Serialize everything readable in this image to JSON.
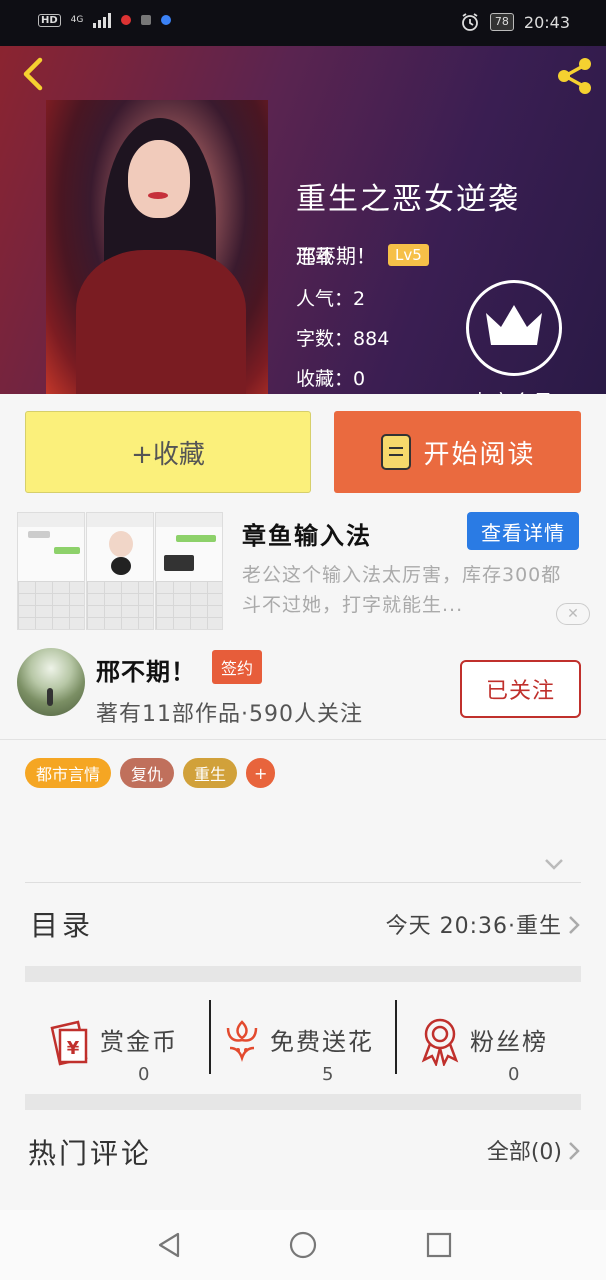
{
  "status_bar": {
    "hd": "HD",
    "network": "4G",
    "battery": "78",
    "time": "20:43"
  },
  "book": {
    "title": "重生之恶女逆袭",
    "author": "邢不期！",
    "author_level": "Lv5",
    "status": "连载",
    "popularity_label": "人气：",
    "popularity": "2",
    "words_label": "字数：",
    "words": "884",
    "favorites_label": "收藏：",
    "favorites": "0",
    "vip_label": "点亮会员"
  },
  "actions": {
    "favorite_label": "+收藏",
    "read_label": "开始阅读"
  },
  "ad": {
    "title": "章鱼输入法",
    "button": "查看详情",
    "description": "老公这个输入法太厉害，库存300都斗不过她，打字就能生..."
  },
  "author_card": {
    "name": "邢不期！",
    "badge": "签约",
    "stats": "著有11部作品·590人关注",
    "follow_label": "已关注"
  },
  "tags": [
    {
      "label": "都市言情",
      "color": "#f5a623"
    },
    {
      "label": "复仇",
      "color": "#c0705c"
    },
    {
      "label": "重生",
      "color": "#d1a13a"
    },
    {
      "label": "+",
      "color": "#e8643c"
    }
  ],
  "toc": {
    "label": "目录",
    "latest": "今天 20:36·重生"
  },
  "stats": [
    {
      "label": "赏金币",
      "value": "0",
      "icon": "red-envelope-yen-icon"
    },
    {
      "label": "免费送花",
      "value": "5",
      "icon": "flower-icon"
    },
    {
      "label": "粉丝榜",
      "value": "0",
      "icon": "medal-icon"
    }
  ],
  "comments": {
    "label": "热门评论",
    "all_label": "全部(0)"
  },
  "colors": {
    "accent_orange": "#ea6a3f",
    "favorite_yellow": "#fbf07b",
    "link_blue": "#2a7be4",
    "follow_red": "#c0302c"
  }
}
